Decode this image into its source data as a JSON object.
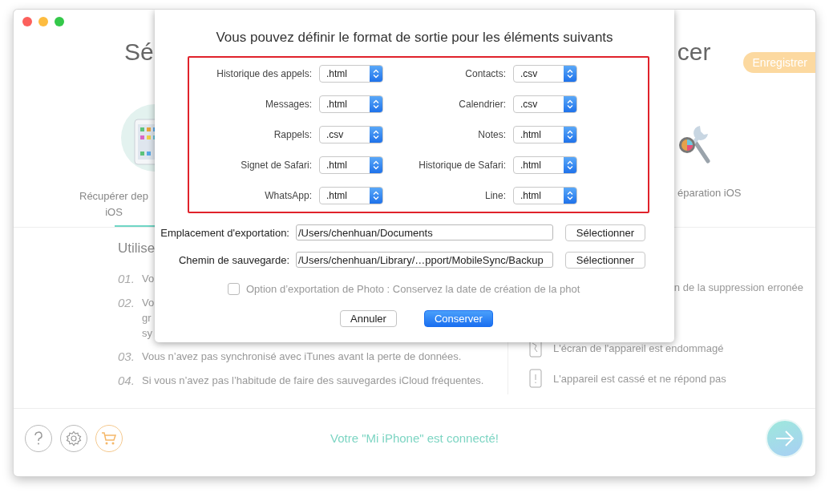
{
  "window": {
    "controls": [
      {
        "kind": "close"
      },
      {
        "kind": "minimize"
      },
      {
        "kind": "zoom"
      }
    ]
  },
  "header": {
    "title_left": "Sé",
    "title_right": "cer",
    "register_button": "Enregistrer"
  },
  "modes": [
    {
      "kind": "device",
      "label_lines": [
        "Récupérer dep",
        "iOS"
      ],
      "selected": true
    },
    {
      "kind": "repair",
      "label_lines": [
        "éparation iOS"
      ],
      "selected": false
    }
  ],
  "causes_left": {
    "heading": "Utilise",
    "items": [
      {
        "number": "01.",
        "lines": [
          "Vo"
        ]
      },
      {
        "number": "02.",
        "lines": [
          "Vo",
          "gr",
          "sy"
        ]
      },
      {
        "number": "03.",
        "lines": [
          "Vous n’avez pas synchronisé avec iTunes avant la perte de données."
        ]
      },
      {
        "number": "04.",
        "lines": [
          "Si vous n’avez pas l’habitude de faire des sauvegardes iCloud fréquentes."
        ]
      }
    ]
  },
  "causes_right": [
    {
      "kind": "text",
      "text": "n de la suppression erronée"
    },
    {
      "kind": "screen",
      "text": "L'écran de l'appareil est endommagé"
    },
    {
      "kind": "broken",
      "text": "L'appareil est cassé et ne répond pas"
    }
  ],
  "footer": {
    "buttons": [
      {
        "kind": "help"
      },
      {
        "kind": "settings"
      },
      {
        "kind": "cart"
      }
    ],
    "status": "Votre \"Mi iPhone\" est connecté!"
  },
  "dialog": {
    "title": "Vous pouvez définir le format de sortie pour les éléments suivants",
    "formats": [
      {
        "label": "Historique des appels:",
        "value": ".html"
      },
      {
        "label": "Contacts:",
        "value": ".csv"
      },
      {
        "label": "Messages:",
        "value": ".html"
      },
      {
        "label": "Calendrier:",
        "value": ".csv"
      },
      {
        "label": "Rappels:",
        "value": ".csv"
      },
      {
        "label": "Notes:",
        "value": ".html"
      },
      {
        "label": "Signet de Safari:",
        "value": ".html"
      },
      {
        "label": "Historique de Safari:",
        "value": ".html"
      },
      {
        "label": "WhatsApp:",
        "value": ".html"
      },
      {
        "label": "Line:",
        "value": ".html"
      }
    ],
    "paths": [
      {
        "label": "Emplacement d'exportation:",
        "value": "/Users/chenhuan/Documents",
        "button": "Sélectionner"
      },
      {
        "label": "Chemin de sauvegarde:",
        "value": "/Users/chenhuan/Library/…pport/MobileSync/Backup",
        "button": "Sélectionner"
      }
    ],
    "photo_option": {
      "label": "Option d’exportation de Photo : Conservez la date de création de la phot",
      "checked": false,
      "disabled": true
    },
    "buttons": [
      {
        "kind": "default",
        "label": "Annuler"
      },
      {
        "kind": "primary",
        "label": "Conserver"
      }
    ]
  }
}
